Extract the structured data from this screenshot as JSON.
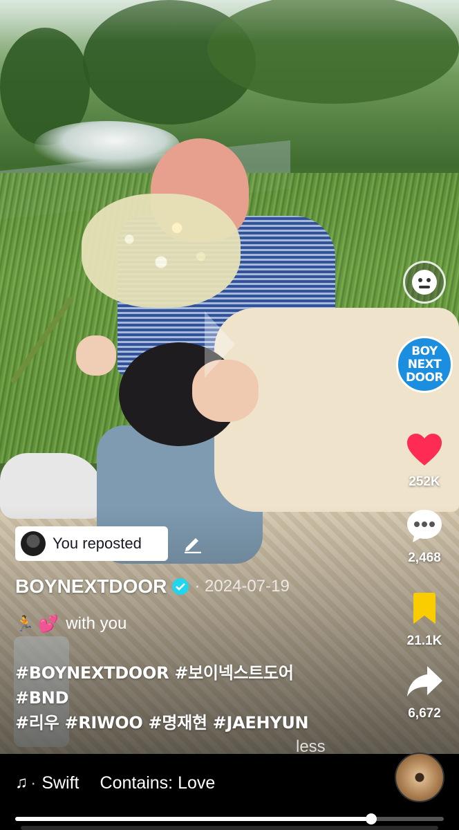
{
  "repost": {
    "label": "You reposted"
  },
  "post": {
    "author": "BOYNEXTDOOR",
    "date": "· 2024-07-19",
    "description": "with you",
    "hashtags_line1": "#BOYNEXTDOOR #보이넥스트도어",
    "hashtags_line2": "#BND",
    "hashtags_line3": "#리우 #RIWOO #명재현 #JAEHYUN",
    "less_label": "less"
  },
  "avatar": {
    "line1": "BOY",
    "line2": "NEXT",
    "line3": "DOOR",
    "color": "#1b8ee0"
  },
  "actions": {
    "likes": "252K",
    "comments": "2,468",
    "saves": "21.1K",
    "shares": "6,672"
  },
  "icons": {
    "face": "face-filter-icon",
    "like": "heart-icon",
    "comment": "comment-icon",
    "save": "bookmark-icon",
    "share": "share-icon",
    "edit": "pencil-icon",
    "verified": "verified-icon",
    "music": "music-note-icon"
  },
  "music": {
    "song": "Swift",
    "contains": "Contains: Love"
  },
  "playback": {
    "progress": 0.83
  },
  "colors": {
    "like": "#fe2c55",
    "save": "#facd00",
    "verified": "#20d5ec"
  }
}
